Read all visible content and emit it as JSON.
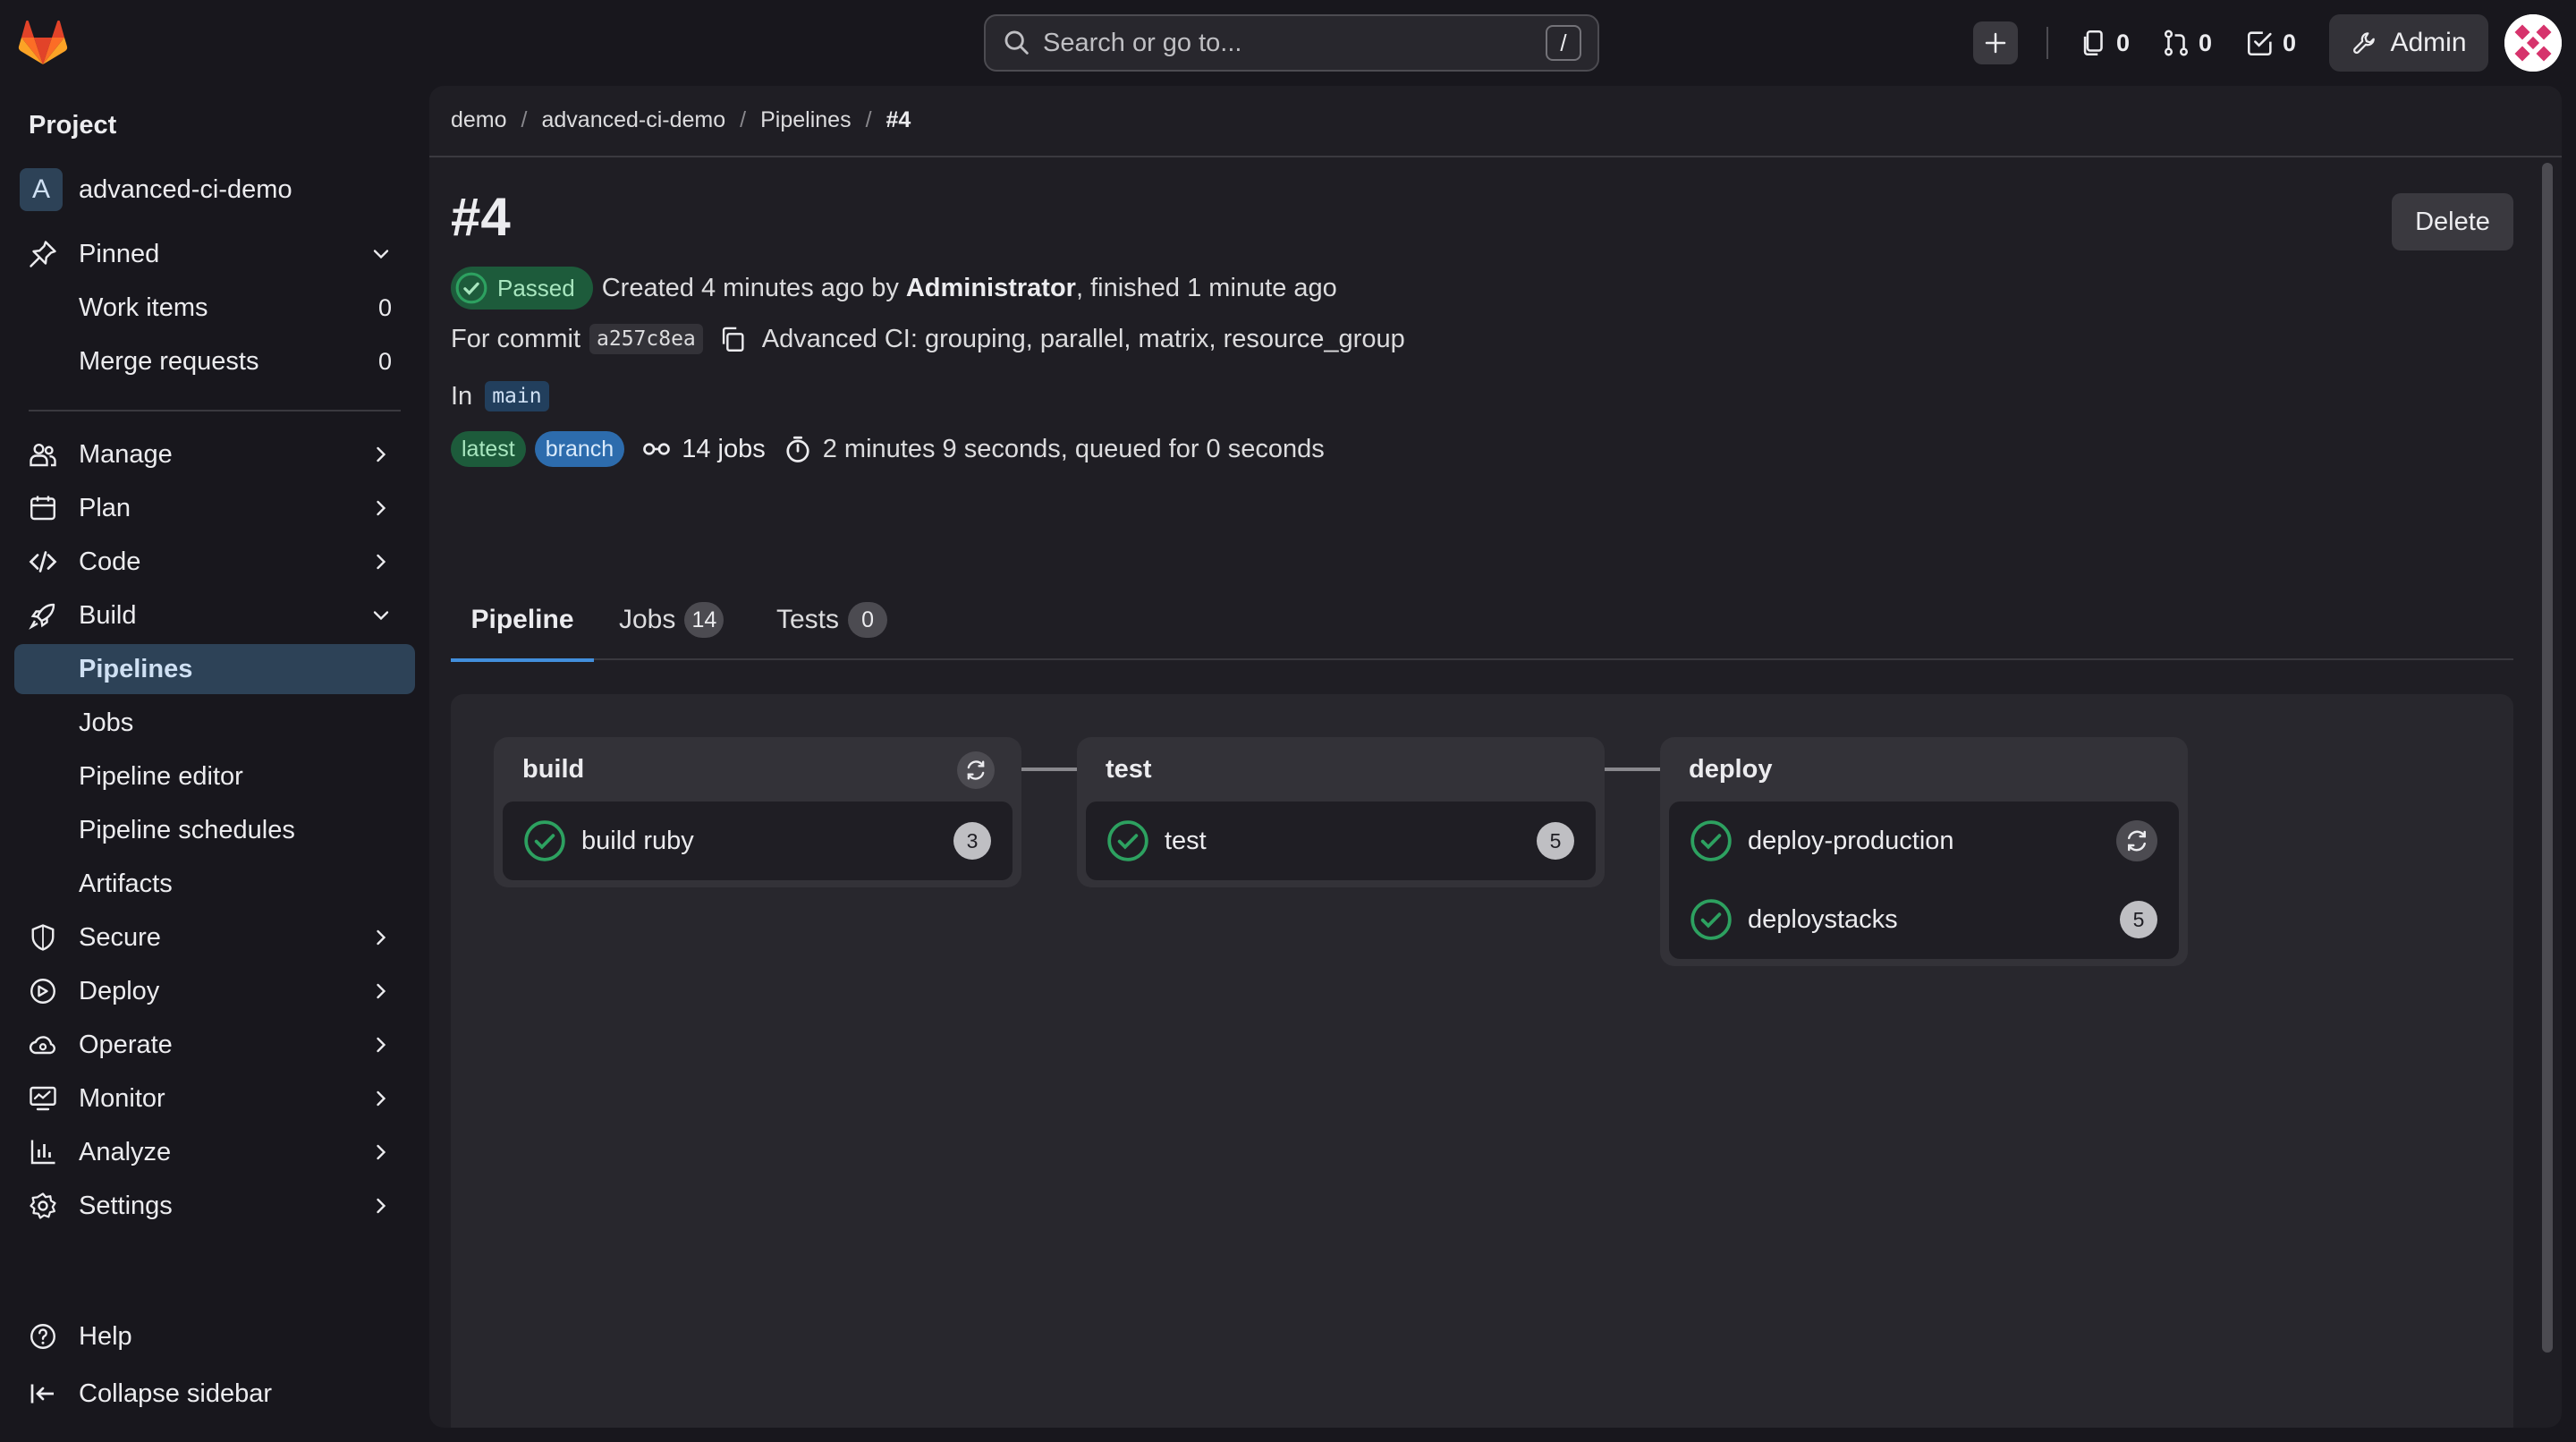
{
  "topbar": {
    "search_placeholder": "Search or go to...",
    "search_shortcut": "/",
    "issues_count": "0",
    "merge_requests_count": "0",
    "todos_count": "0",
    "admin_label": "Admin"
  },
  "sidebar": {
    "section_title": "Project",
    "project_initial": "A",
    "project_name": "advanced-ci-demo",
    "pinned": {
      "label": "Pinned"
    },
    "pinned_items": [
      {
        "label": "Work items",
        "count": "0"
      },
      {
        "label": "Merge requests",
        "count": "0"
      }
    ],
    "menu": [
      {
        "label": "Manage"
      },
      {
        "label": "Plan"
      },
      {
        "label": "Code"
      },
      {
        "label": "Build"
      },
      {
        "label": "Pipelines"
      },
      {
        "label": "Jobs"
      },
      {
        "label": "Pipeline editor"
      },
      {
        "label": "Pipeline schedules"
      },
      {
        "label": "Artifacts"
      },
      {
        "label": "Secure"
      },
      {
        "label": "Deploy"
      },
      {
        "label": "Operate"
      },
      {
        "label": "Monitor"
      },
      {
        "label": "Analyze"
      },
      {
        "label": "Settings"
      }
    ],
    "help_label": "Help",
    "collapse_label": "Collapse sidebar"
  },
  "breadcrumb": [
    "demo",
    "advanced-ci-demo",
    "Pipelines",
    "#4"
  ],
  "pipeline": {
    "title": "#4",
    "delete_label": "Delete",
    "status": "Passed",
    "created_prefix": "Created 4 minutes ago by",
    "author": "Administrator",
    "finished": ", finished 1 minute ago",
    "commit_prefix": "For commit",
    "commit_sha": "a257c8ea",
    "commit_message": "Advanced CI: grouping, parallel, matrix, resource_group",
    "branch_prefix": "In",
    "branch": "main",
    "badges": [
      "latest",
      "branch"
    ],
    "jobs_count_text": "14 jobs",
    "duration_text": "2 minutes 9 seconds, queued for 0 seconds"
  },
  "tabs": [
    {
      "label": "Pipeline"
    },
    {
      "label": "Jobs",
      "count": "14"
    },
    {
      "label": "Tests",
      "count": "0"
    }
  ],
  "stages": [
    {
      "name": "build",
      "jobs": [
        {
          "name": "build ruby",
          "count": "3"
        }
      ]
    },
    {
      "name": "test",
      "jobs": [
        {
          "name": "test",
          "count": "5"
        }
      ]
    },
    {
      "name": "deploy",
      "jobs": [
        {
          "name": "deploy-production"
        },
        {
          "name": "deploystacks",
          "count": "5"
        }
      ]
    }
  ],
  "colors": {
    "success": "#2da160",
    "accent": "#428fdc",
    "background": "#18171d"
  }
}
